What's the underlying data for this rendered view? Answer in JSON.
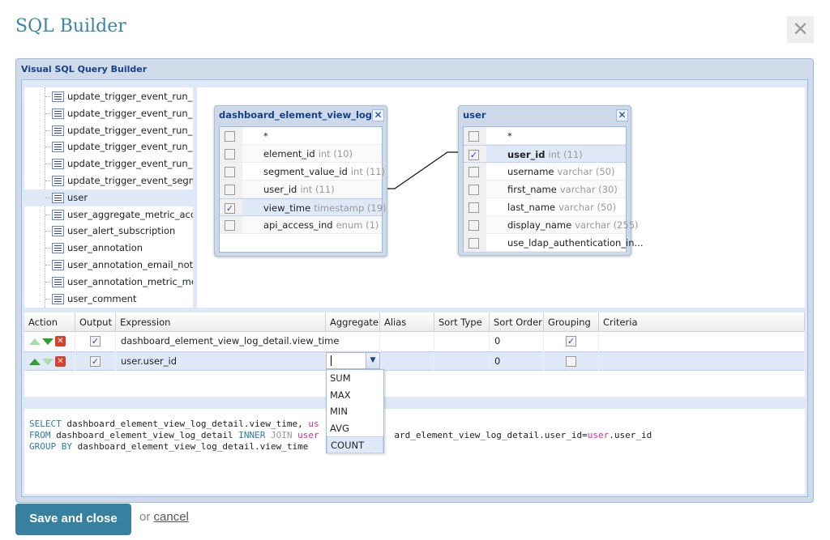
{
  "title": "SQL Builder",
  "close_icon": "close-x",
  "panel_title": "Visual SQL Query Builder",
  "tree": {
    "items": [
      {
        "label": "update_trigger_event_run_list",
        "selected": false
      },
      {
        "label": "update_trigger_event_run_list_",
        "selected": false
      },
      {
        "label": "update_trigger_event_run_log",
        "selected": false
      },
      {
        "label": "update_trigger_event_run_log_",
        "selected": false
      },
      {
        "label": "update_trigger_event_run_thre",
        "selected": false
      },
      {
        "label": "update_trigger_event_segmen",
        "selected": false
      },
      {
        "label": "user",
        "selected": true
      },
      {
        "label": "user_aggregate_metric_access",
        "selected": false
      },
      {
        "label": "user_alert_subscription",
        "selected": false
      },
      {
        "label": "user_annotation",
        "selected": false
      },
      {
        "label": "user_annotation_email_notifica",
        "selected": false
      },
      {
        "label": "user_annotation_metric_measu",
        "selected": false
      },
      {
        "label": "user_comment",
        "selected": false
      }
    ]
  },
  "tables": [
    {
      "name": "dashboard_element_view_log...",
      "fields": [
        {
          "name": "*",
          "type": "",
          "checked": false
        },
        {
          "name": "element_id",
          "type": "int (10)",
          "checked": false
        },
        {
          "name": "segment_value_id",
          "type": "int (11)",
          "checked": false
        },
        {
          "name": "user_id",
          "type": "int (11)",
          "checked": false
        },
        {
          "name": "view_time",
          "type": "timestamp (19)",
          "checked": true
        },
        {
          "name": "api_access_ind",
          "type": "enum (1)",
          "checked": false
        }
      ]
    },
    {
      "name": "user",
      "fields": [
        {
          "name": "*",
          "type": "",
          "checked": false
        },
        {
          "name": "user_id",
          "type": "int (11)",
          "checked": true
        },
        {
          "name": "username",
          "type": "varchar (50)",
          "checked": false
        },
        {
          "name": "first_name",
          "type": "varchar (30)",
          "checked": false
        },
        {
          "name": "last_name",
          "type": "varchar (50)",
          "checked": false
        },
        {
          "name": "display_name",
          "type": "varchar (255)",
          "checked": false
        },
        {
          "name": "use_ldap_authentication_in...",
          "type": "",
          "checked": false
        }
      ]
    }
  ],
  "grid": {
    "columns": [
      "Action",
      "Output",
      "Expression",
      "Aggregate",
      "Alias",
      "Sort Type",
      "Sort Order",
      "Grouping",
      "Criteria"
    ],
    "rows": [
      {
        "output": true,
        "expression": "dashboard_element_view_log_detail.view_time",
        "aggregate": "",
        "alias": "",
        "sort_type": "",
        "sort_order": "0",
        "grouping": true,
        "criteria": "",
        "up_enabled": false,
        "down_enabled": true
      },
      {
        "output": true,
        "expression": "user.user_id",
        "aggregate": "",
        "alias": "",
        "sort_type": "",
        "sort_order": "0",
        "grouping": false,
        "criteria": "",
        "up_enabled": true,
        "down_enabled": false
      }
    ]
  },
  "aggregate_options": [
    "SUM",
    "MAX",
    "MIN",
    "AVG",
    "COUNT"
  ],
  "aggregate_highlighted": "COUNT",
  "sql": {
    "line1": {
      "kw": "SELECT",
      "text": " dashboard_element_view_log_detail.view_time, ",
      "pink": "us"
    },
    "line2": {
      "kw": "FROM",
      "text": " dashboard_element_view_log_detail ",
      "kw2": "INNER",
      "kw3": " JOIN ",
      "pink": "user",
      "text2": "ard_element_view_log_detail.user_id=",
      "pink2": "user",
      "text3": ".user_id"
    },
    "line3": {
      "kw": "GROUP BY",
      "text": " dashboard_element_view_log_detail.view_time"
    }
  },
  "footer": {
    "save_label": "Save and close",
    "or_text": "or ",
    "cancel_label": "cancel"
  },
  "colors": {
    "accent": "#37809f",
    "title": "#3a86a6",
    "panel_header": "#15428b",
    "keyword": "#2c7aa8",
    "table_ref": "#e0279a"
  }
}
